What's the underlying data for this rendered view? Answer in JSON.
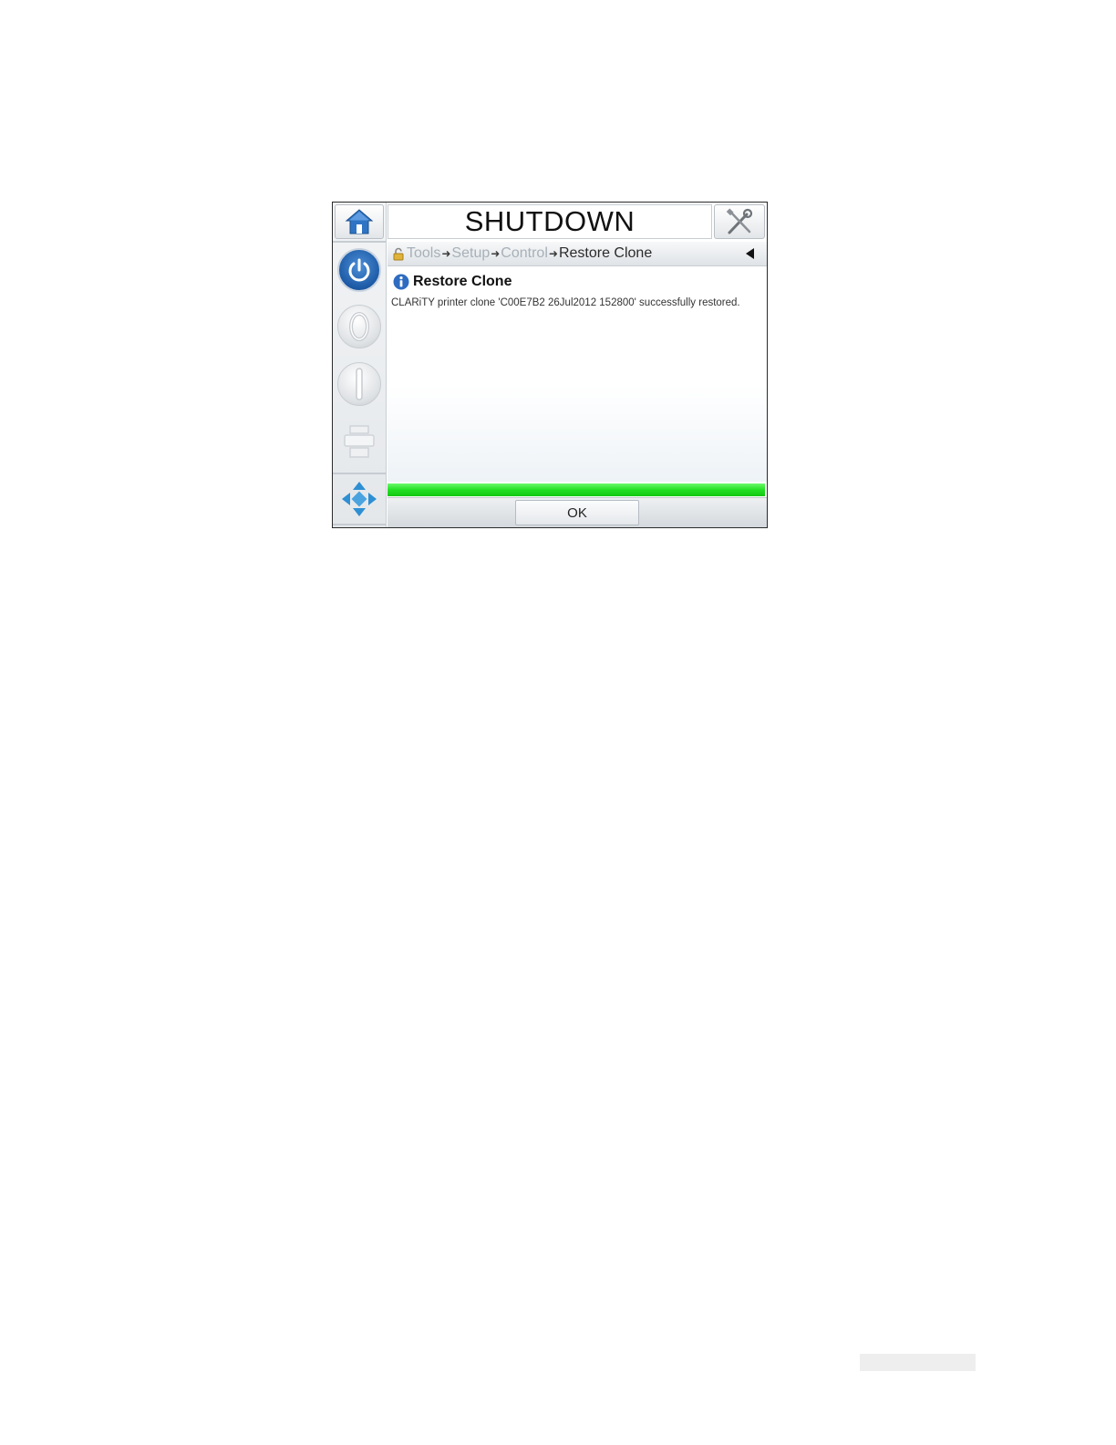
{
  "header": {
    "title": "SHUTDOWN"
  },
  "breadcrumb": {
    "items": [
      "Tools",
      "Setup",
      "Control"
    ],
    "current": "Restore Clone",
    "separator": "➜"
  },
  "dialog": {
    "title": "Restore Clone",
    "message": "CLARiTY printer clone 'C00E7B2 26Jul2012 152800' successfully restored.",
    "progress_percent": 100,
    "ok_label": "OK"
  },
  "colors": {
    "accent_blue": "#1d5aa6",
    "progress_green": "#22e022"
  },
  "icons": {
    "home": "home-icon",
    "tools": "tools-icon",
    "power": "power-icon",
    "lock": "lock-icon",
    "back": "back-arrow-icon",
    "info": "info-icon",
    "navigate": "navigate-arrows-icon"
  }
}
